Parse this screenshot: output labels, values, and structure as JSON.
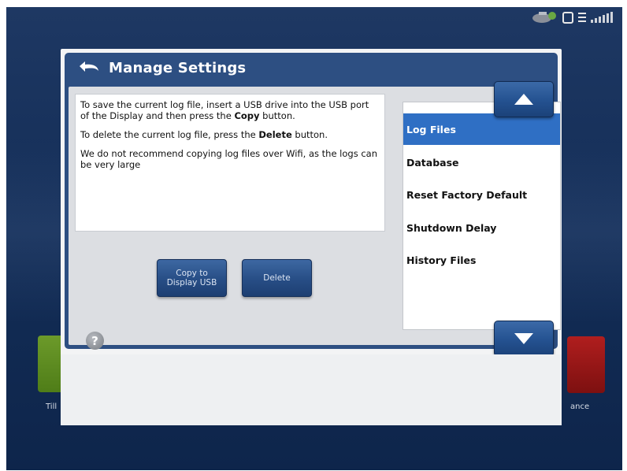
{
  "dialog": {
    "title": "Manage Settings",
    "message": {
      "p1_before": "To save the current log file, insert a USB drive into the USB port of the Display and then press the ",
      "p1_bold": "Copy",
      "p1_after": " button.",
      "p2_before": "To delete the current log file, press the ",
      "p2_bold": "Delete",
      "p2_after": " button.",
      "p3": "We do not recommend copying log files over Wifi, as the logs can be very large"
    },
    "buttons": {
      "copy_line1": "Copy to",
      "copy_line2": "Display USB",
      "delete": "Delete"
    },
    "help_symbol": "?",
    "list": {
      "items": [
        {
          "label": "Log Files",
          "selected": true
        },
        {
          "label": "Database",
          "selected": false
        },
        {
          "label": "Reset Factory Default",
          "selected": false
        },
        {
          "label": "Shutdown Delay",
          "selected": false
        },
        {
          "label": "History Files",
          "selected": false
        }
      ]
    }
  },
  "background": {
    "tile_left_label": "Till",
    "tile_right_label": "ance"
  },
  "icons": {
    "back": "back-arrow-icon",
    "up": "triangle-up-icon",
    "down": "triangle-down-icon",
    "help": "help-icon",
    "gps": "gps-icon",
    "signal": "signal-icon"
  },
  "colors": {
    "title_bar": "#2d4f82",
    "selected_item": "#2f6fc4",
    "button": "#274d85"
  }
}
